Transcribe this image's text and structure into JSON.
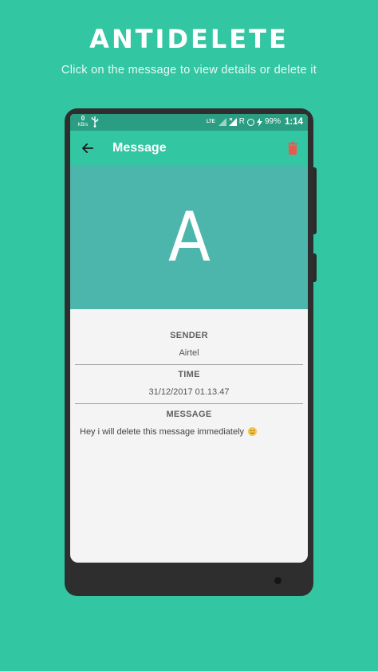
{
  "promo": {
    "title": "ANTIDELETE",
    "subtitle": "Click on the message to view details or delete it"
  },
  "statusbar": {
    "speed_value": "0",
    "speed_unit": "KB/s",
    "network": "LTE",
    "roaming": "R",
    "battery": "99%",
    "time": "1:14"
  },
  "appbar": {
    "title": "Message",
    "back_icon": "arrow-left-icon",
    "delete_icon": "trash-icon",
    "delete_color": "#e85a4f"
  },
  "avatar": {
    "letter": "A",
    "background": "#4db6ac"
  },
  "details": {
    "sender_label": "SENDER",
    "sender_value": "Airtel",
    "time_label": "TIME",
    "time_value": "31/12/2017 01.13.47",
    "message_label": "MESSAGE",
    "message_value": "Hey i will delete this message immediately",
    "message_emoji": "smiling-face-icon"
  },
  "colors": {
    "background": "#33c6a2",
    "statusbar": "#2a9e83",
    "appbar": "#33c6a2",
    "content": "#f4f4f4"
  }
}
